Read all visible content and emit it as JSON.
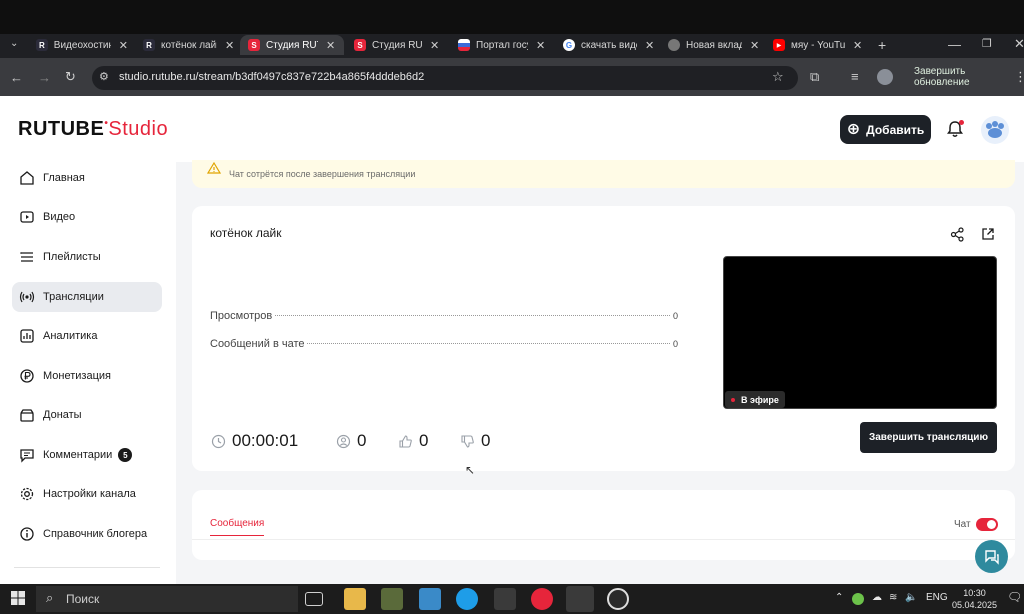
{
  "browser": {
    "tabs": [
      {
        "label": "Видеохостинг",
        "favicon_text": "R",
        "favicon_color": "#2b2b3a"
      },
      {
        "label": "котёнок лайк",
        "favicon_text": "R",
        "favicon_color": "#2b2b3a"
      },
      {
        "label": "Студия RUTUBE",
        "favicon_text": "S",
        "favicon_color": "#e6253b",
        "active": true
      },
      {
        "label": "Студия RUTUBE",
        "favicon_text": "S",
        "favicon_color": "#e6253b"
      },
      {
        "label": "Портал госуслуг",
        "favicon_text": "",
        "favicon_color": "#3a6ad8"
      },
      {
        "label": "скачать видео",
        "favicon_text": "G",
        "favicon_color": "#ffffff"
      },
      {
        "label": "Новая вкладка",
        "favicon_text": "",
        "favicon_color": "#777777"
      },
      {
        "label": "мяу - YouTube",
        "favicon_text": "▶",
        "favicon_color": "#ff0000"
      }
    ],
    "url": "studio.rutube.ru/stream/b3df0497c837e722b4a865f4dddeb6d2",
    "update_button": "Завершить обновление"
  },
  "header": {
    "logo_main": "RUTUBE",
    "logo_studio": "Studio",
    "add_button": "Добавить",
    "accent_color": "#e6253b"
  },
  "sidebar": {
    "items": [
      {
        "label": "Главная",
        "icon": "home-icon"
      },
      {
        "label": "Видео",
        "icon": "video-icon"
      },
      {
        "label": "Плейлисты",
        "icon": "playlist-icon"
      },
      {
        "label": "Трансляции",
        "icon": "broadcast-icon",
        "active": true
      },
      {
        "label": "Аналитика",
        "icon": "analytics-icon"
      },
      {
        "label": "Монетизация",
        "icon": "ruble-icon"
      },
      {
        "label": "Донаты",
        "icon": "gift-icon"
      },
      {
        "label": "Комментарии",
        "icon": "comment-icon",
        "badge": "5"
      },
      {
        "label": "Настройки канала",
        "icon": "gear-icon"
      },
      {
        "label": "Справочник блогера",
        "icon": "info-icon"
      }
    ]
  },
  "notice": {
    "text": "Чат сотрётся после завершения трансляции"
  },
  "stream": {
    "title": "котёнок лайк",
    "stats": [
      {
        "label": "Просмотров",
        "value": "0"
      },
      {
        "label": "Сообщений в чате",
        "value": "0"
      }
    ],
    "live_label": "В эфире",
    "timer": "00:00:01",
    "viewers": "0",
    "likes": "0",
    "dislikes": "0",
    "end_button": "Завершить трансляцию"
  },
  "chat": {
    "tab_label": "Сообщения",
    "toggle_label": "Чат",
    "enabled": true
  },
  "taskbar": {
    "search_placeholder": "Поиск",
    "language": "ENG",
    "time": "10:30",
    "date": "05.04.2025"
  }
}
